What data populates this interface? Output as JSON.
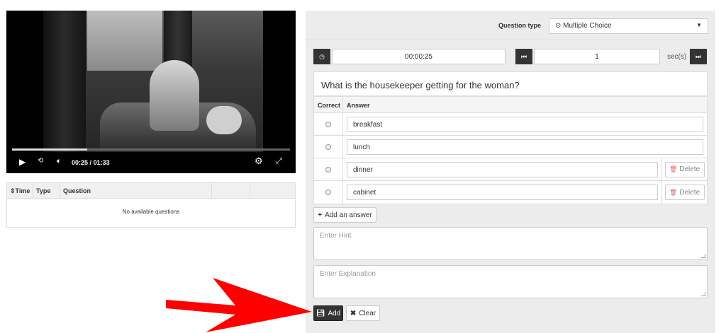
{
  "video": {
    "current_time": "00:25",
    "separator": "/",
    "duration": "01:33",
    "progress": 0.27
  },
  "question_list": {
    "columns": [
      "Time",
      "Type",
      "Question"
    ],
    "empty_text": "No available questions"
  },
  "editor": {
    "question_type_label": "Question type",
    "question_type_value": "Multiple Choice",
    "timestamp": "00:00:25",
    "skip_seconds": "1",
    "seconds_unit": "sec(s)",
    "question_text": "What is the housekeeper getting for the woman?",
    "answers_header": {
      "correct": "Correct",
      "answer": "Answer"
    },
    "answers": [
      {
        "text": "breakfast",
        "deletable": false
      },
      {
        "text": "lunch",
        "deletable": false
      },
      {
        "text": "dinner",
        "deletable": true
      },
      {
        "text": "cabinet",
        "deletable": true
      }
    ],
    "delete_label": "Delete",
    "add_answer_label": "Add an answer",
    "hint_placeholder": "Enter Hint",
    "explanation_placeholder": "Enter Explanation",
    "add_label": "Add",
    "clear_label": "Clear"
  },
  "colors": {
    "arrow": "#ff0000",
    "dark_button": "#333333",
    "panel_bg": "#ececec"
  }
}
